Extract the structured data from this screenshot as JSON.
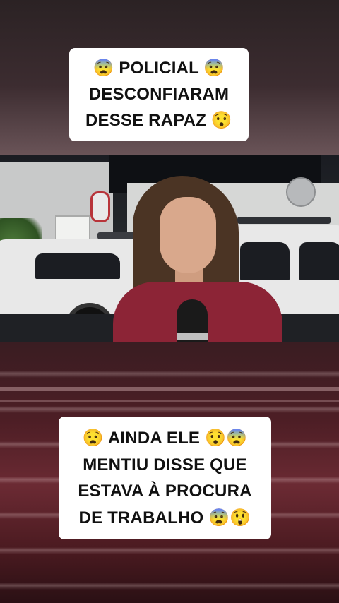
{
  "top_caption": {
    "line1": "😨 POLICIAL 😨",
    "line2": "DESCONFIARAM",
    "line3": "DESSE RAPAZ 😯"
  },
  "bottom_caption": {
    "line1": "😧 AINDA ELE 😯😨",
    "line2": "MENTIU DISSE QUE",
    "line3": "ESTAVA À PROCURA",
    "line4": "DE TRABALHO 😨😲"
  },
  "colors": {
    "card_background": "#ffffff",
    "caption_text": "#111111",
    "shirt": "#8c2436",
    "police_stripe": "#b8343a"
  }
}
